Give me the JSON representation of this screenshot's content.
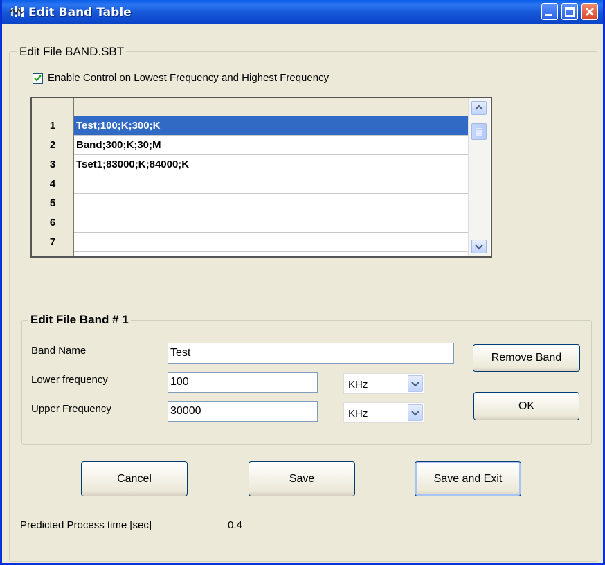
{
  "window": {
    "title": "Edit Band Table"
  },
  "file_group": {
    "title": "Edit File BAND.SBT"
  },
  "enable_control": {
    "label": "Enable Control on Lowest Frequency and Highest Frequency",
    "checked": true
  },
  "table": {
    "rows": [
      {
        "num": "1",
        "value": "Test;100;K;300;K",
        "selected": true
      },
      {
        "num": "2",
        "value": "Band;300;K;30;M"
      },
      {
        "num": "3",
        "value": "Tset1;83000;K;84000;K"
      },
      {
        "num": "4",
        "value": ""
      },
      {
        "num": "5",
        "value": ""
      },
      {
        "num": "6",
        "value": ""
      },
      {
        "num": "7",
        "value": ""
      }
    ]
  },
  "band_group": {
    "title": "Edit File Band # 1",
    "band_name_label": "Band Name",
    "band_name_value": "Test",
    "lower_label": "Lower frequency",
    "lower_value": "100",
    "lower_unit": "KHz",
    "upper_label": "Upper Frequency",
    "upper_value": "30000",
    "upper_unit": "KHz",
    "remove_button": "Remove Band",
    "ok_button": "OK"
  },
  "buttons": {
    "cancel": "Cancel",
    "save": "Save",
    "save_exit": "Save and Exit"
  },
  "status": {
    "label": "Predicted Process time [sec]",
    "value": "0.4"
  },
  "colors": {
    "title_bar": "#0a5ee8",
    "selection": "#316ac5",
    "dialog_bg": "#ece9d8",
    "close_button": "#d8452a"
  },
  "icons": {
    "app": "band-table-app-icon",
    "minimize": "minimize-icon",
    "maximize": "maximize-icon",
    "close": "close-icon",
    "check": "checkmark-icon",
    "dropdown": "chevron-down-icon",
    "scroll_up": "arrow-up-icon",
    "scroll_down": "arrow-down-icon"
  }
}
